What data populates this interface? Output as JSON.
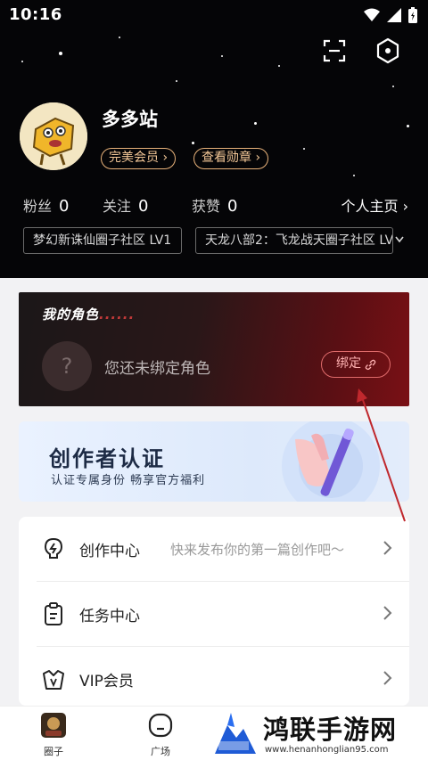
{
  "status_bar": {
    "time": "10:16"
  },
  "profile": {
    "username": "多多站",
    "badges": [
      "完美会员 ›",
      "查看勋章 ›"
    ],
    "stats": [
      {
        "label": "粉丝",
        "value": "0"
      },
      {
        "label": "关注",
        "value": "0"
      },
      {
        "label": "获赞",
        "value": "0"
      }
    ],
    "homepage_link": "个人主页 ›",
    "communities": [
      "梦幻新诛仙圈子社区 LV1",
      "天龙八部2：飞龙战天圈子社区 LV"
    ]
  },
  "role_card": {
    "title": "我的角色",
    "dots": "......",
    "placeholder_icon": "?",
    "empty_text": "您还未绑定角色",
    "bind_button": "绑定"
  },
  "creator_banner": {
    "title": "创作者认证",
    "subtitle": "认证专属身份  畅享官方福利"
  },
  "menu": [
    {
      "label": "创作中心",
      "hint": "快来发布你的第一篇创作吧～",
      "icon": "lightbulb-icon"
    },
    {
      "label": "任务中心",
      "hint": "",
      "icon": "clipboard-icon"
    },
    {
      "label": "VIP会员",
      "hint": "",
      "icon": "vip-crown-icon"
    }
  ],
  "bottom_nav": [
    {
      "label": "圈子",
      "icon": "circle-avatar-icon"
    },
    {
      "label": "广场",
      "icon": "square-icon"
    }
  ],
  "watermark": {
    "text": "鸿联手游网",
    "url": "www.henanhonglian95.com"
  },
  "colors": {
    "accent_gold": "#e8b27a",
    "role_red": "#e06b6b",
    "annotation_arrow": "#c0282d"
  }
}
